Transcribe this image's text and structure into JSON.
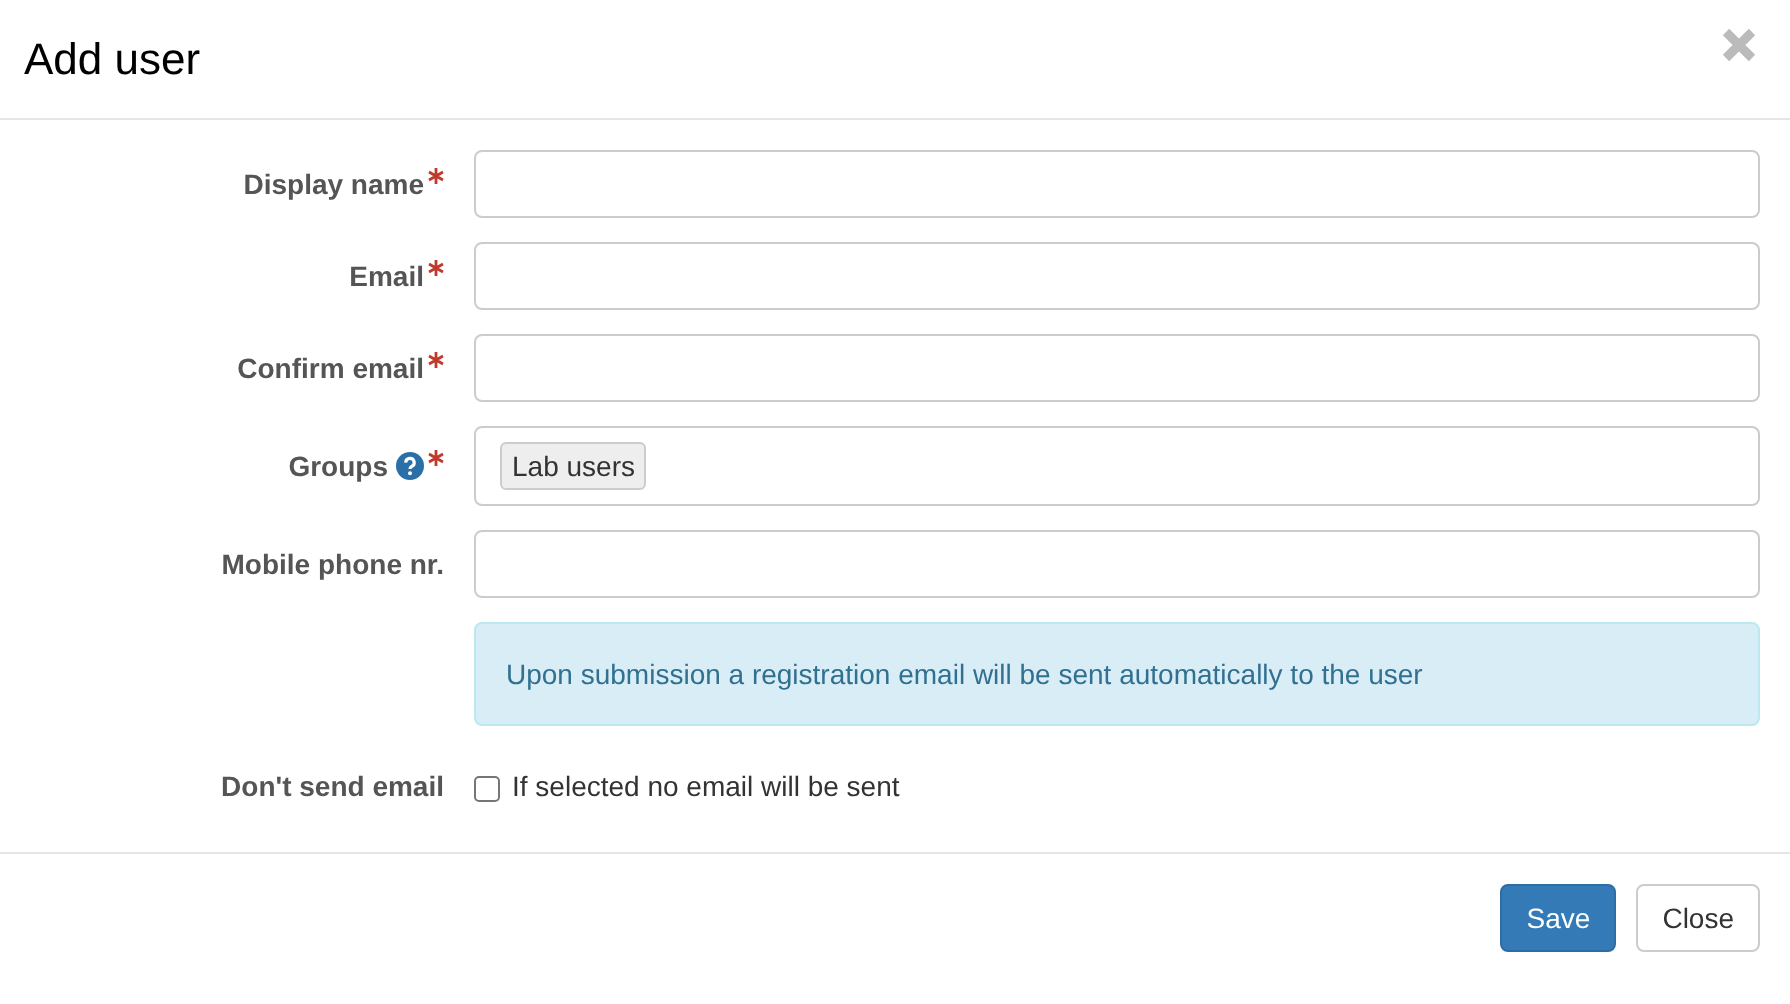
{
  "dialog": {
    "title": "Add user"
  },
  "fields": [
    {
      "kind": "text",
      "label": "Display name",
      "required": true,
      "help": false
    },
    {
      "kind": "text",
      "label": "Email",
      "required": true,
      "help": false
    },
    {
      "kind": "text",
      "label": "Confirm email",
      "required": true,
      "help": false
    },
    {
      "kind": "tags",
      "label": "Groups",
      "required": true,
      "help": true,
      "tags": [
        "Lab users"
      ]
    },
    {
      "kind": "text",
      "label": "Mobile phone nr.",
      "required": false,
      "help": false
    }
  ],
  "notice": "Upon submission a registration email will be sent automatically to the user",
  "option": {
    "label": "Don't send email",
    "text": "If selected no email will be sent",
    "checked": false
  },
  "buttons": [
    {
      "kind": "primary",
      "label": "Save"
    },
    {
      "kind": "default",
      "label": "Close"
    }
  ]
}
